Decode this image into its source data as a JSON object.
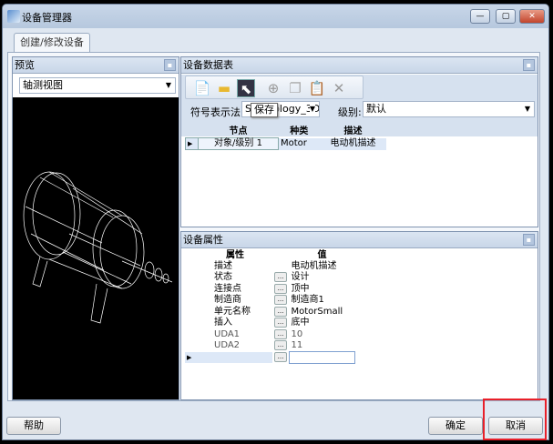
{
  "window": {
    "title": "设备管理器",
    "minimize": "—",
    "maximize": "▢",
    "close": "✕"
  },
  "tab": {
    "label": "创建/修改设备"
  },
  "preview": {
    "title": "预览",
    "view_select": "轴测视图"
  },
  "datatable": {
    "title": "设备数据表",
    "toolbar": {
      "tooltip": "保存"
    },
    "symbol_label": "符号表示法:",
    "symbol_value": "Symbology_3D",
    "level_label": "级别:",
    "level_value": "默认",
    "columns": [
      "节点",
      "种类",
      "描述"
    ],
    "rows": [
      {
        "node": "对象/级别 1",
        "type": "Motor",
        "desc": "电动机描述"
      }
    ]
  },
  "properties": {
    "title": "设备属性",
    "columns": [
      "属性",
      "值"
    ],
    "rows": [
      {
        "name": "描述",
        "value": "电动机描述",
        "btn": false
      },
      {
        "name": "状态",
        "value": "设计",
        "btn": true
      },
      {
        "name": "连接点",
        "value": "顶中",
        "btn": true
      },
      {
        "name": "制造商",
        "value": "制造商1",
        "btn": true
      },
      {
        "name": "单元名称",
        "value": "MotorSmall",
        "btn": true
      },
      {
        "name": "插入",
        "value": "底中",
        "btn": true
      },
      {
        "name": "UDA1",
        "value": "10",
        "btn": true
      },
      {
        "name": "UDA2",
        "value": "11",
        "btn": true
      }
    ],
    "dots": "..."
  },
  "buttons": {
    "help": "帮助",
    "ok": "确定",
    "cancel": "取消"
  },
  "colors": {
    "highlight": "#e8202a"
  }
}
